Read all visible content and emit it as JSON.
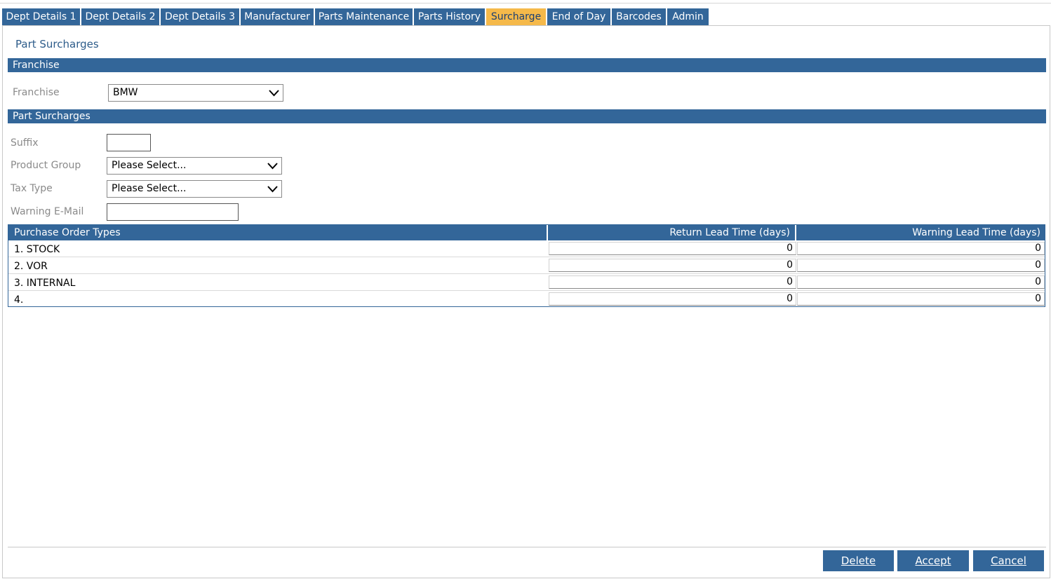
{
  "tabs": [
    {
      "label": "Dept Details 1",
      "active": false
    },
    {
      "label": "Dept Details 2",
      "active": false
    },
    {
      "label": "Dept Details 3",
      "active": false
    },
    {
      "label": "Manufacturer",
      "active": false
    },
    {
      "label": "Parts Maintenance",
      "active": false
    },
    {
      "label": "Parts History",
      "active": false
    },
    {
      "label": "Surcharge",
      "active": true
    },
    {
      "label": "End of Day",
      "active": false
    },
    {
      "label": "Barcodes",
      "active": false
    },
    {
      "label": "Admin",
      "active": false
    }
  ],
  "page": {
    "title": "Part Surcharges"
  },
  "franchise_section": {
    "header": "Franchise",
    "franchise_label": "Franchise",
    "franchise_value": "BMW"
  },
  "surcharge_section": {
    "header": "Part Surcharges",
    "suffix_label": "Suffix",
    "suffix_value": "",
    "product_group_label": "Product Group",
    "product_group_value": "Please Select...",
    "tax_type_label": "Tax Type",
    "tax_type_value": "Please Select...",
    "warning_email_label": "Warning E-Mail",
    "warning_email_value": ""
  },
  "grid": {
    "headers": [
      "Purchase Order Types",
      "Return Lead Time (days)",
      "Warning Lead Time (days)"
    ],
    "rows": [
      {
        "type": "1. STOCK",
        "return_lead": "0",
        "warning_lead": "0"
      },
      {
        "type": "2. VOR",
        "return_lead": "0",
        "warning_lead": "0"
      },
      {
        "type": "3. INTERNAL",
        "return_lead": "0",
        "warning_lead": "0"
      },
      {
        "type": "4.",
        "return_lead": "0",
        "warning_lead": "0"
      }
    ]
  },
  "buttons": {
    "delete": "Delete",
    "accept": "Accept",
    "cancel": "Cancel"
  },
  "colors": {
    "primary": "#336699",
    "active_tab": "#f5b94a",
    "title": "#2d5c8a",
    "label": "#8a8a8a"
  },
  "icons": {
    "dropdown": "chevron-down-icon"
  }
}
